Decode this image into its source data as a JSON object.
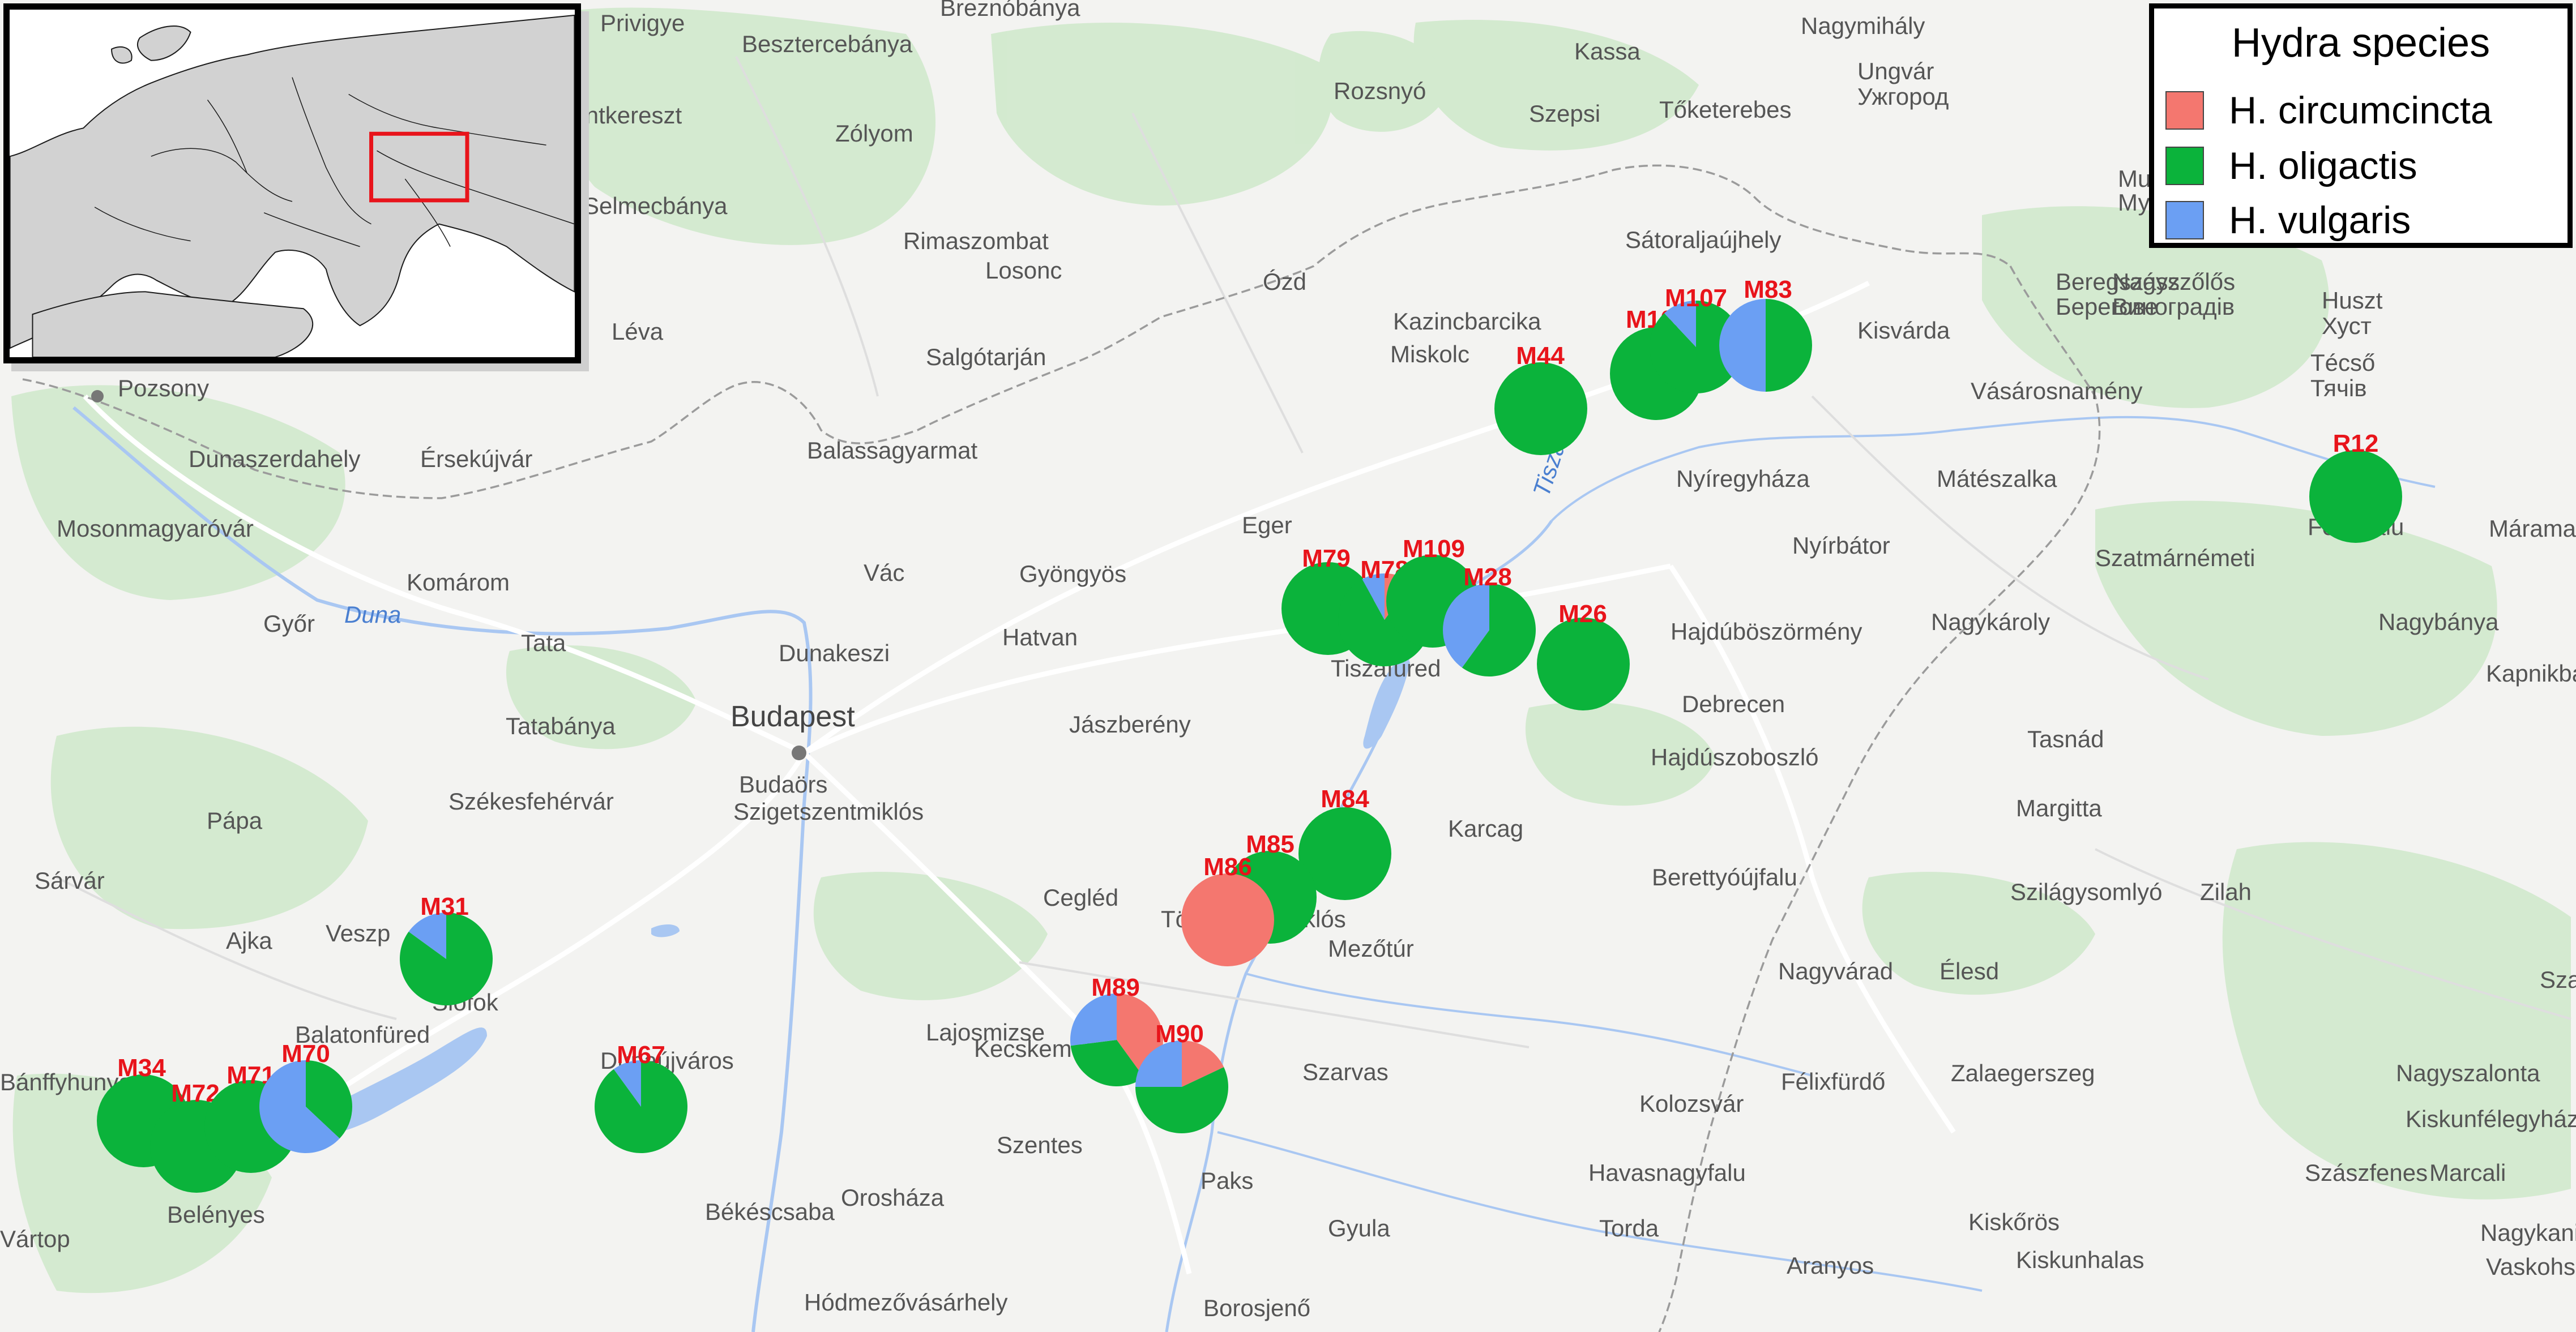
{
  "legend": {
    "title": "Hydra species",
    "items": [
      {
        "label": "H. circumcincta",
        "color": "#f4776f"
      },
      {
        "label": "H. oligactis",
        "color": "#0bb33b"
      },
      {
        "label": "H. vulgaris",
        "color": "#6b9ff3"
      }
    ]
  },
  "colors": {
    "circumcincta": "#f4776f",
    "oligactis": "#0bb33b",
    "vulgaris": "#6b9ff3",
    "site_label": "#e8141b",
    "inset_frame": "#e8141b"
  },
  "sites": [
    {
      "id": "M79",
      "mix": {
        "circumcincta": 0,
        "oligactis": 1,
        "vulgaris": 0
      }
    },
    {
      "id": "M78",
      "mix": {
        "circumcincta": 0.1,
        "oligactis": 0.82,
        "vulgaris": 0.08
      }
    },
    {
      "id": "M109",
      "mix": {
        "circumcincta": 0,
        "oligactis": 1,
        "vulgaris": 0
      }
    },
    {
      "id": "M28",
      "mix": {
        "circumcincta": 0,
        "oligactis": 0.6,
        "vulgaris": 0.4
      }
    },
    {
      "id": "M26",
      "mix": {
        "circumcincta": 0,
        "oligactis": 1,
        "vulgaris": 0
      }
    },
    {
      "id": "M44",
      "mix": {
        "circumcincta": 0,
        "oligactis": 1,
        "vulgaris": 0
      }
    },
    {
      "id": "M108",
      "mix": {
        "circumcincta": 0,
        "oligactis": 1,
        "vulgaris": 0
      }
    },
    {
      "id": "M107",
      "mix": {
        "circumcincta": 0,
        "oligactis": 0.88,
        "vulgaris": 0.12
      }
    },
    {
      "id": "M83",
      "mix": {
        "circumcincta": 0,
        "oligactis": 0.5,
        "vulgaris": 0.5
      }
    },
    {
      "id": "R12",
      "mix": {
        "circumcincta": 0,
        "oligactis": 1,
        "vulgaris": 0
      }
    },
    {
      "id": "M84",
      "mix": {
        "circumcincta": 0,
        "oligactis": 1,
        "vulgaris": 0
      }
    },
    {
      "id": "M85",
      "mix": {
        "circumcincta": 0,
        "oligactis": 1,
        "vulgaris": 0
      }
    },
    {
      "id": "M86",
      "mix": {
        "circumcincta": 1,
        "oligactis": 0,
        "vulgaris": 0
      }
    },
    {
      "id": "M31",
      "mix": {
        "circumcincta": 0,
        "oligactis": 0.85,
        "vulgaris": 0.15
      }
    },
    {
      "id": "M67",
      "mix": {
        "circumcincta": 0,
        "oligactis": 0.9,
        "vulgaris": 0.1
      }
    },
    {
      "id": "M89",
      "mix": {
        "circumcincta": 0.4,
        "oligactis": 0.33,
        "vulgaris": 0.27
      }
    },
    {
      "id": "M90",
      "mix": {
        "circumcincta": 0.18,
        "oligactis": 0.57,
        "vulgaris": 0.25
      }
    },
    {
      "id": "M34",
      "mix": {
        "circumcincta": 0,
        "oligactis": 1,
        "vulgaris": 0
      }
    },
    {
      "id": "M72",
      "mix": {
        "circumcincta": 0,
        "oligactis": 1,
        "vulgaris": 0
      }
    },
    {
      "id": "M71",
      "mix": {
        "circumcincta": 0,
        "oligactis": 1,
        "vulgaris": 0
      }
    },
    {
      "id": "M70",
      "mix": {
        "circumcincta": 0,
        "oligactis": 0.37,
        "vulgaris": 0.63
      }
    }
  ],
  "place_labels": [
    "Privigye",
    "Besztercebánya",
    "Breznóbánya",
    "Kassa",
    "Nagymihály",
    "Ungvár",
    "Ужгород",
    "Munk",
    "Мукач",
    "Zólyom",
    "Rozsnyó",
    "Szepsi",
    "Tőketerebes",
    "Garamszentkereszt",
    "Selmecbánya",
    "Rimaszombat",
    "Sátoraljaújhely",
    "Beregszász",
    "Берегове",
    "Nagyszőlős",
    "Виноградів",
    "Huszt",
    "Хуст",
    "Losonc",
    "Ózd",
    "Kazincbarcika",
    "Léva",
    "Salgótarján",
    "Miskolc",
    "Kisvárda",
    "Vásárosnamény",
    "Técső",
    "Тячів",
    "Pozsony",
    "Dunaszerdahely",
    "Érsekújvár",
    "Balassagyarmat",
    "Nyíregyháza",
    "Mátészalka",
    "Mosonmagyaróvár",
    "Eger",
    "Tisza",
    "Nyírbátor",
    "Felsőfalu",
    "Máramar",
    "Komárom",
    "Vác",
    "Gyöngyös",
    "Szatmárnémeti",
    "Győr",
    "Duna",
    "Tata",
    "Hatvan",
    "Dunakeszi",
    "Hajdúböszörmény",
    "Nagykároly",
    "Nagybánya",
    "Tiszafüred",
    "Kapnikbá",
    "Tatabánya",
    "Budapest",
    "Jászberény",
    "Debrecen",
    "Budaörs",
    "Szigetszentmiklós",
    "Hajdúszoboszló",
    "Tasnád",
    "Pápa",
    "Karcag",
    "Margitta",
    "Sárvár",
    "Székesfehérvár",
    "Berettyóújfalu",
    "Szilágysomlyó",
    "Zilah",
    "Cegléd",
    "Törökszentmiklós",
    "Ajka",
    "Veszp",
    "Mezőtúr",
    "Nagyvárad",
    "Élesd",
    "Szamo",
    "Lajosmizse",
    "Siófok",
    "Dunaújváros",
    "Balatonfüred",
    "Kecskemét",
    "Szarvas",
    "Félixfürdő",
    "Bánffyhunyad",
    "Zalaegerszeg",
    "Nagyszalonta",
    "Kolozsvár",
    "Kiskunfélegyháza",
    "Szentes",
    "Paks",
    "Békéscsaba",
    "Havasnagyfalu",
    "Szászfenes",
    "Marcali",
    "Belényes",
    "Kiskőrös",
    "Orosháza",
    "Gyula",
    "Torda",
    "Nagykanizsa",
    "Vaskohsziklás",
    "Vártop",
    "Aranyos",
    "Kiskunhalas",
    "Hódmezővásárhely",
    "Borosjenő"
  ]
}
